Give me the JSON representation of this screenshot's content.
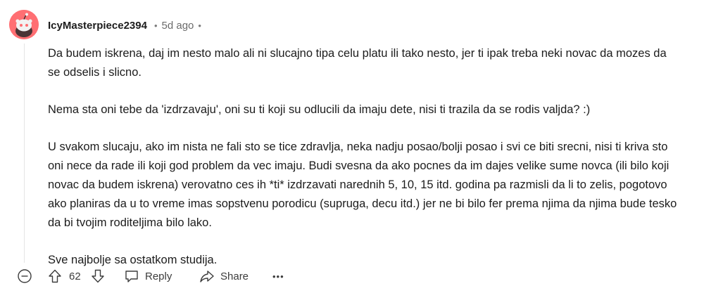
{
  "comment": {
    "username": "IcyMasterpiece2394",
    "time_separator": "•",
    "time": "5d ago",
    "trailing_separator": "•",
    "paragraphs": [
      "Da budem iskrena, daj im nesto malo ali ni slucajno tipa celu platu ili tako nesto, jer ti ipak treba neki novac da mozes da se odselis i slicno.",
      "Nema sta oni tebe da 'izdrzavaju', oni su ti koji su odlucili da imaju dete, nisi ti trazila da se rodis valjda? :)",
      "U svakom slucaju, ako im nista ne fali sto se tice zdravlja, neka nadju posao/bolji posao i svi ce biti srecni, nisi ti kriva sto oni nece da rade ili koji god problem da vec imaju. Budi svesna da ako pocnes da im dajes velike sume novca (ili bilo koji novac da budem iskrena) verovatno ces ih *ti* izdrzavati narednih 5, 10, 15 itd. godina pa razmisli da li to zelis, pogotovo ako planiras da u to vreme imas sopstvenu porodicu (supruga, decu itd.) jer ne bi bilo fer prema njima da njima bude tesko da bi tvojim roditeljima bilo lako.",
      "Sve najbolje sa ostatkom studija."
    ]
  },
  "actions": {
    "collapse_icon": "collapse-minus-icon",
    "upvote_icon": "upvote-arrow-icon",
    "score": "62",
    "downvote_icon": "downvote-arrow-icon",
    "reply_icon": "speech-bubble-icon",
    "reply_label": "Reply",
    "share_icon": "share-arrow-icon",
    "share_label": "Share",
    "more_label": "•••"
  },
  "colors": {
    "avatar_bg": "#ff6f73",
    "text": "#1c1c1c",
    "muted": "#6b6b6b",
    "icon": "#3c3c3c"
  }
}
